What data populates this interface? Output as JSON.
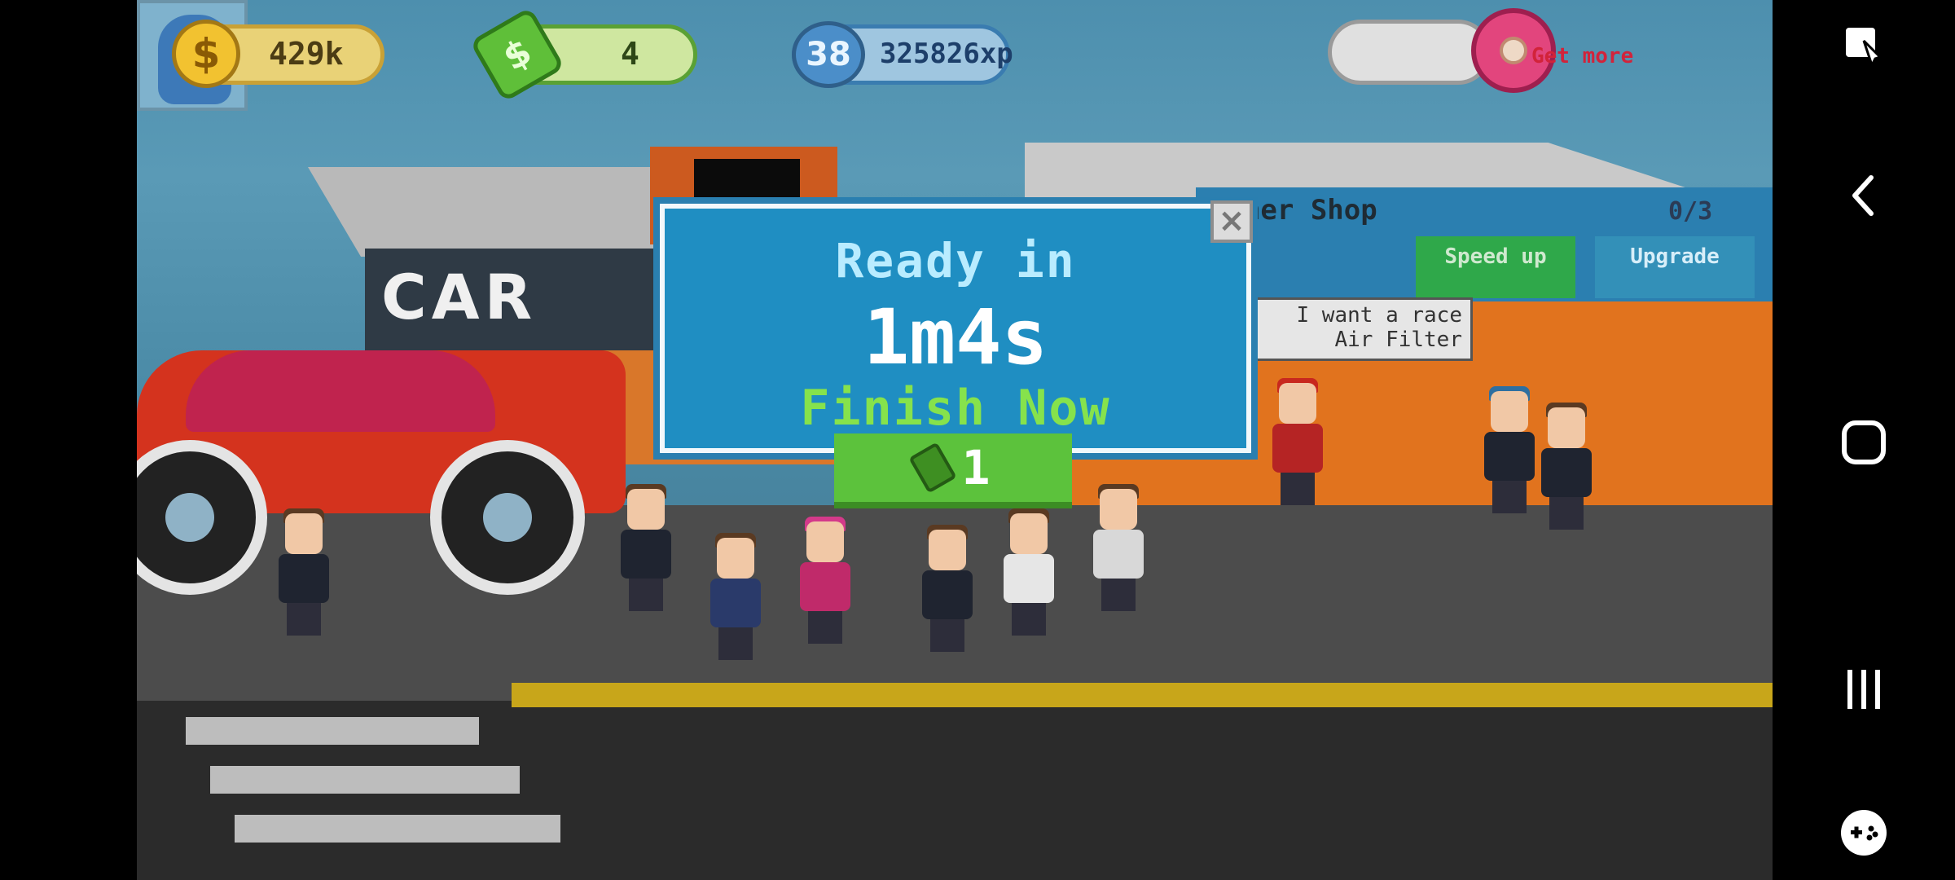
{
  "hud": {
    "coins": "429k",
    "cash": "4",
    "level": "38",
    "xp": "325826xp",
    "donut_cta": "Get more",
    "plus": "+"
  },
  "shop": {
    "title": "Tuner Shop",
    "slots": "0/3",
    "speed_up": "Speed up",
    "upgrade": "Upgrade",
    "speech": "I want a race Air Filter",
    "car_sign": "CAR"
  },
  "dialog": {
    "title": "Ready in",
    "timer": "1m4s",
    "finish_label": "Finish Now",
    "cost": "1",
    "close": "×"
  },
  "nav": {
    "icons": [
      "screenshot-edit-icon",
      "back-icon",
      "home-icon",
      "recent-apps-icon",
      "game-tools-icon"
    ]
  },
  "colors": {
    "dialog_bg": "#1f8ec2",
    "finish_green": "#5cc23c",
    "coin_gold": "#f2c230",
    "cash_green": "#5fbf39",
    "donut_pink": "#e2457d"
  }
}
